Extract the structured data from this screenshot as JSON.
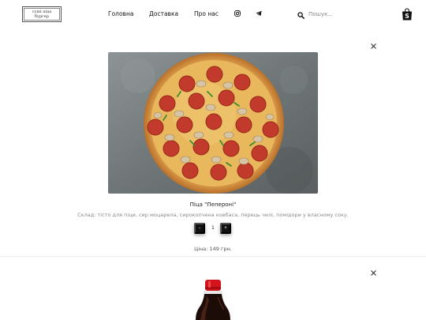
{
  "logo": {
    "lines": [
      "суші піца",
      "бургер"
    ]
  },
  "nav": {
    "links": [
      "Головна",
      "Доставка",
      "Про нас"
    ]
  },
  "search": {
    "placeholder": "Пошук..."
  },
  "product1": {
    "title": "Піца \"Пепероні\"",
    "description": "Склад: тісто для піци, сир моцарела, сирокопчена ковбаса, перець чилі, помідори у власному соку.",
    "decrement_label": "-",
    "increment_label": "+",
    "quantity": "1",
    "price": "Ціна: 149 грн."
  },
  "colors": {
    "accent": "#111111",
    "muted_text": "#8a8a8a",
    "cola_red": "#d4141c"
  }
}
